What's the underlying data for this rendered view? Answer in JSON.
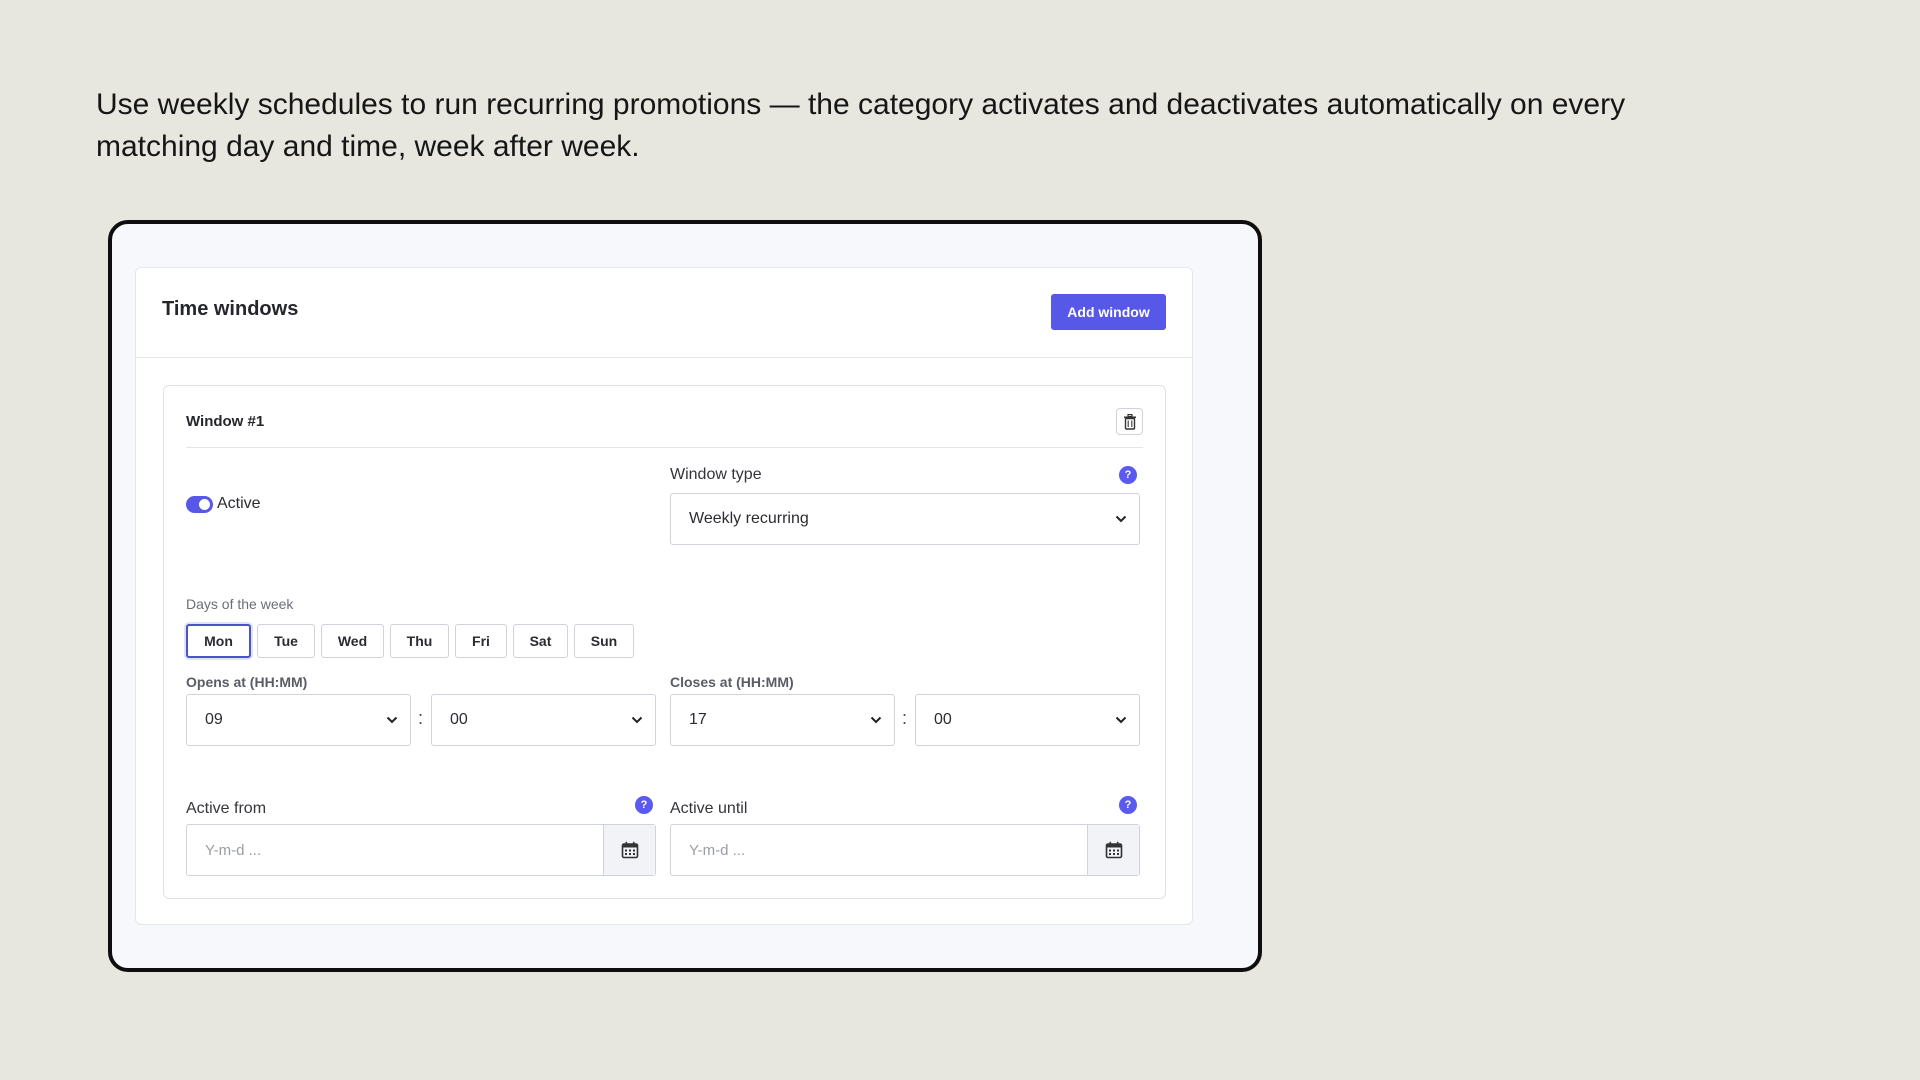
{
  "intro_text": "Use weekly schedules to run recurring promotions — the category activates and deactivates automatically on every matching day and time, week after week.",
  "card": {
    "title": "Time windows",
    "add_button": "Add window"
  },
  "window": {
    "title": "Window #1",
    "active_label": "Active",
    "active": true,
    "window_type_label": "Window type",
    "window_type_value": "Weekly recurring",
    "days_label": "Days of the week",
    "days": [
      "Mon",
      "Tue",
      "Wed",
      "Thu",
      "Fri",
      "Sat",
      "Sun"
    ],
    "selected_day": "Mon",
    "opens_label": "Opens at (HH:MM)",
    "opens_hour": "09",
    "opens_minute": "00",
    "closes_label": "Closes at (HH:MM)",
    "closes_hour": "17",
    "closes_minute": "00",
    "time_separator": ":",
    "active_from_label": "Active from",
    "active_until_label": "Active until",
    "date_placeholder": "Y-m-d ..."
  },
  "icons": {
    "help": "?"
  },
  "colors": {
    "accent": "#5858e8",
    "background": "#e7e7df"
  }
}
